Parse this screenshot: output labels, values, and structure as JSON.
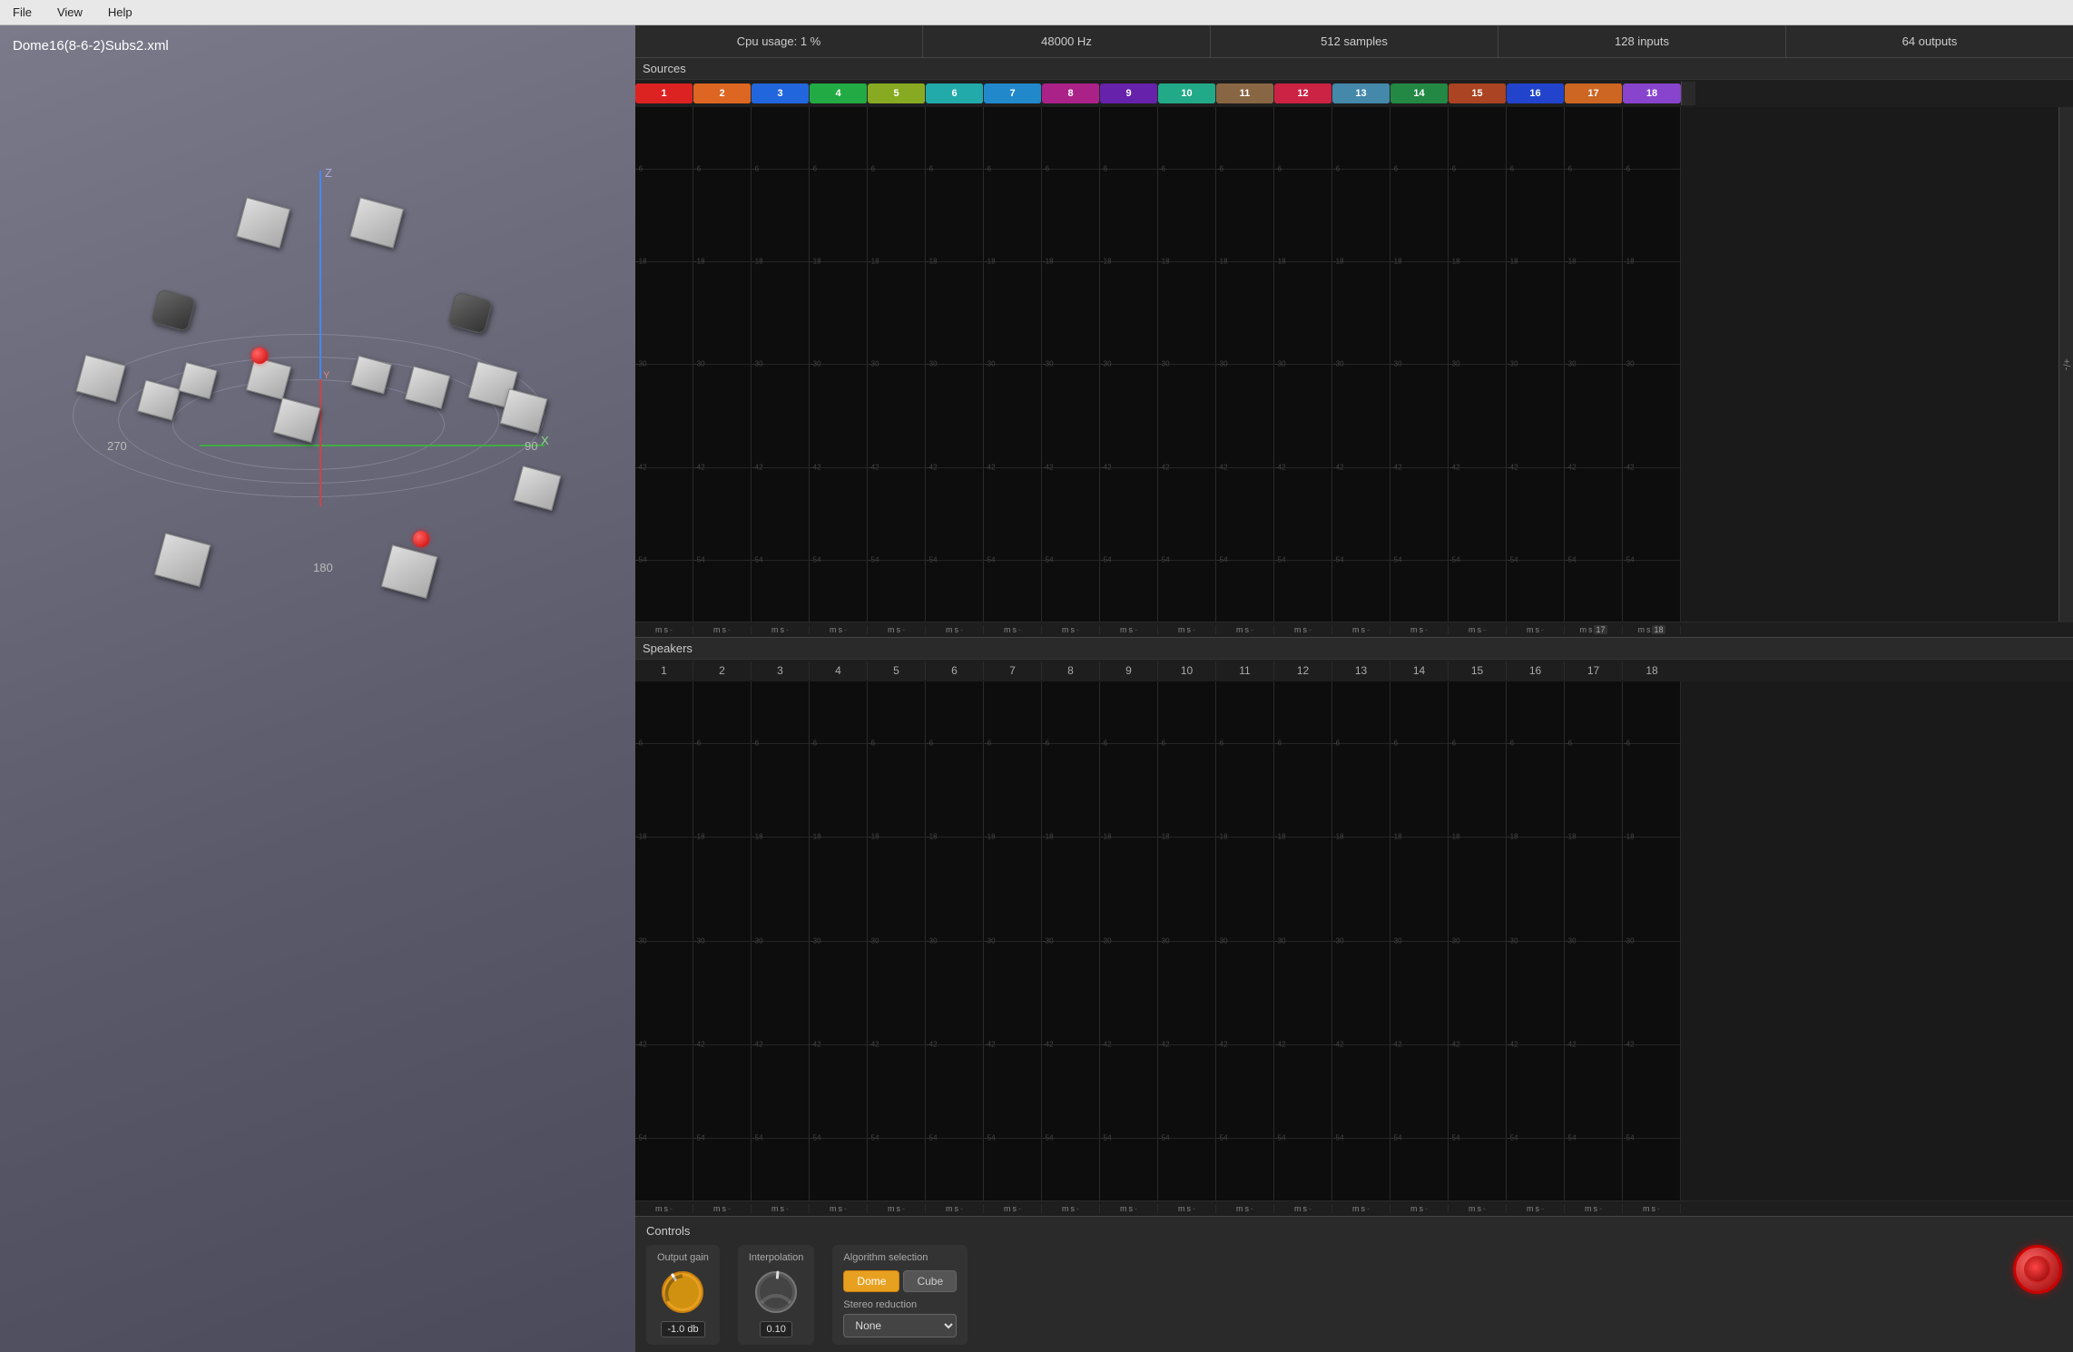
{
  "menubar": {
    "items": [
      "File",
      "View",
      "Help"
    ]
  },
  "viewport": {
    "title": "Dome16(8-6-2)Subs2.xml",
    "compass": {
      "label_270": "270",
      "label_180": "180",
      "label_90": "90"
    }
  },
  "stats": {
    "cpu": "Cpu usage: 1 %",
    "sample_rate": "48000 Hz",
    "buffer": "512 samples",
    "inputs": "128 inputs",
    "outputs": "64 outputs"
  },
  "sources": {
    "title": "Sources",
    "channels": [
      1,
      2,
      3,
      4,
      5,
      6,
      7,
      8,
      9,
      10,
      11,
      12,
      13,
      14,
      15,
      16,
      17,
      18
    ],
    "db_labels": [
      "-6",
      "-18",
      "-30",
      "-42",
      "-54"
    ],
    "ms_row": [
      "m",
      "s",
      "m",
      "s",
      "m",
      "s",
      "m",
      "s",
      "m",
      "s",
      "m",
      "s",
      "m",
      "s",
      "m",
      "s",
      "m",
      "s",
      "m",
      "s",
      "m",
      "s",
      "m",
      "s",
      "m",
      "s",
      "m",
      "s",
      "m",
      "s",
      "m",
      "s",
      "m",
      "s",
      "m",
      "s"
    ],
    "special_17": "17",
    "special_18": "18"
  },
  "speakers": {
    "title": "Speakers",
    "channels": [
      1,
      2,
      3,
      4,
      5,
      6,
      7,
      8,
      9,
      10,
      11,
      12,
      13,
      14,
      15,
      16,
      17,
      18
    ],
    "db_labels": [
      "-6",
      "-18",
      "-30",
      "-42",
      "-54"
    ],
    "ms_row": [
      "m",
      "s",
      "m",
      "s",
      "m",
      "s",
      "m",
      "s",
      "m",
      "s",
      "m",
      "s",
      "m",
      "s",
      "m",
      "s",
      "m",
      "s",
      "m",
      "s",
      "m",
      "s",
      "m",
      "s",
      "m",
      "s",
      "m",
      "s",
      "m",
      "s",
      "m",
      "s",
      "m",
      "s",
      "m",
      "s"
    ]
  },
  "controls": {
    "title": "Controls",
    "output_gain": {
      "label": "Output gain",
      "value": "-1.0 db"
    },
    "interpolation": {
      "label": "Interpolation",
      "value": "0.10"
    },
    "algorithm": {
      "title": "Algorithm selection",
      "dome_label": "Dome",
      "cube_label": "Cube",
      "active": "Dome"
    },
    "stereo_reduction": {
      "label": "Stereo reduction",
      "options": [
        "None"
      ],
      "selected": "None"
    }
  },
  "scrollbar": {
    "label": "+/-"
  }
}
